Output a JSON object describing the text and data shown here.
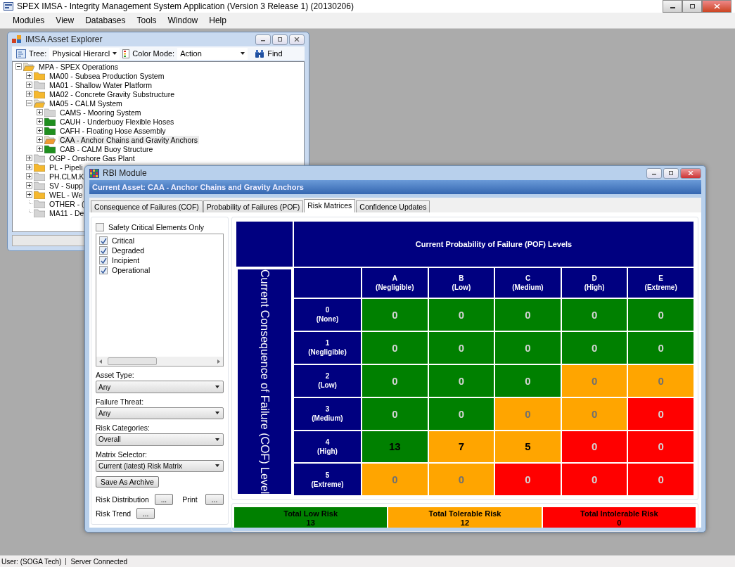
{
  "app_window": {
    "title": "SPEX IMSA - Integrity Management System Application (Version 3 Release 1) (20130206)"
  },
  "menu": [
    "Modules",
    "View",
    "Databases",
    "Tools",
    "Window",
    "Help"
  ],
  "asset_explorer": {
    "title": "IMSA Asset Explorer",
    "tree_label": "Tree:",
    "tree_value": "Physical Hierarcl",
    "color_mode_label": "Color Mode:",
    "color_mode_value": "Action",
    "find": "Find",
    "tree": [
      {
        "label": "MPA - SPEX Operations",
        "color": "#f5b82e",
        "expandable": true,
        "expanded": true,
        "selected": false,
        "children": [
          {
            "label": "MA00 - Subsea Production System",
            "color": "#f5b82e",
            "expandable": true,
            "expanded": false,
            "selected": false
          },
          {
            "label": "MA01 - Shallow Water Platform",
            "color": "#d4d4d4",
            "expandable": true,
            "expanded": false,
            "selected": false
          },
          {
            "label": "MA02 - Concrete Gravity Substructure",
            "color": "#f5b82e",
            "expandable": true,
            "expanded": false,
            "selected": false
          },
          {
            "label": "MA05 - CALM System",
            "color": "#f5b82e",
            "expandable": true,
            "expanded": true,
            "selected": false,
            "children": [
              {
                "label": "CAMS - Mooring System",
                "color": "#d4d4d4",
                "expandable": true,
                "expanded": false,
                "selected": false
              },
              {
                "label": "CAUH - Underbuoy Flexible Hoses",
                "color": "#1f8f1f",
                "expandable": true,
                "expanded": false,
                "selected": false
              },
              {
                "label": "CAFH - Floating Hose Assembly",
                "color": "#1f8f1f",
                "expandable": true,
                "expanded": false,
                "selected": false
              },
              {
                "label": "CAA - Anchor Chains and Gravity Anchors",
                "color": "#f09a30",
                "expandable": true,
                "expanded": false,
                "selected": true
              },
              {
                "label": "CAB - CALM Buoy Structure",
                "color": "#1f8f1f",
                "expandable": true,
                "expanded": false,
                "selected": false
              }
            ]
          },
          {
            "label": "OGP - Onshore Gas Plant",
            "color": "#d4d4d4",
            "expandable": true,
            "expanded": false,
            "selected": false
          },
          {
            "label": "PL - Pipeli",
            "color": "#f5b82e",
            "expandable": true,
            "expanded": false,
            "selected": false
          },
          {
            "label": "PH.CLM.K",
            "color": "#d4d4d4",
            "expandable": true,
            "expanded": false,
            "selected": false
          },
          {
            "label": "SV - Supp",
            "color": "#d4d4d4",
            "expandable": true,
            "expanded": false,
            "selected": false
          },
          {
            "label": "WEL - We",
            "color": "#f5b82e",
            "expandable": true,
            "expanded": false,
            "selected": false
          },
          {
            "label": "OTHER - (",
            "color": "#d4d4d4",
            "expandable": false,
            "expanded": false,
            "selected": false
          },
          {
            "label": "MA11 - De",
            "color": "#d4d4d4",
            "expandable": false,
            "expanded": false,
            "selected": false
          }
        ]
      }
    ]
  },
  "rbi_module": {
    "title": "RBI Module",
    "current_asset": "Current Asset: CAA - Anchor Chains and Gravity Anchors",
    "tabs": [
      {
        "label": "Consequence of Failures (COF)",
        "selected": false
      },
      {
        "label": "Probability of Failures (POF)",
        "selected": false
      },
      {
        "label": "Risk Matrices",
        "selected": true
      },
      {
        "label": "Confidence Updates",
        "selected": false
      }
    ],
    "safety_critical": {
      "label": "Safety Critical Elements Only",
      "checked": false
    },
    "conditions": [
      {
        "label": "Critical",
        "checked": true
      },
      {
        "label": "Degraded",
        "checked": true
      },
      {
        "label": "Incipient",
        "checked": true
      },
      {
        "label": "Operational",
        "checked": true
      }
    ],
    "filters": [
      {
        "label": "Asset Type:",
        "value": "Any"
      },
      {
        "label": "Failure Threat:",
        "value": "Any"
      },
      {
        "label": "Risk Categories:",
        "value": "Overall"
      },
      {
        "label": "Matrix Selector:",
        "value": "Current (latest) Risk Matrix"
      }
    ],
    "save_button": "Save As Archive",
    "actions": [
      {
        "label": "Risk Distribution",
        "button": "..."
      },
      {
        "label": "Print",
        "button": "..."
      },
      {
        "label": "Risk Trend",
        "button": "..."
      }
    ],
    "matrix": {
      "title": "Current Probability of Failure (POF) Levels",
      "side_title": "Current Consequence of Failure (COF) Level",
      "columns": [
        {
          "letter": "A",
          "name": "(Negligible)"
        },
        {
          "letter": "B",
          "name": "(Low)"
        },
        {
          "letter": "C",
          "name": "(Medium)"
        },
        {
          "letter": "D",
          "name": "(High)"
        },
        {
          "letter": "E",
          "name": "(Extreme)"
        }
      ],
      "rows": [
        {
          "number": "0",
          "name": "(None)",
          "cells": [
            {
              "value": "0",
              "color": "#008000",
              "muted": true
            },
            {
              "value": "0",
              "color": "#008000",
              "muted": true
            },
            {
              "value": "0",
              "color": "#008000",
              "muted": true
            },
            {
              "value": "0",
              "color": "#008000",
              "muted": true
            },
            {
              "value": "0",
              "color": "#008000",
              "muted": true
            }
          ]
        },
        {
          "number": "1",
          "name": "(Negligible)",
          "cells": [
            {
              "value": "0",
              "color": "#008000",
              "muted": true
            },
            {
              "value": "0",
              "color": "#008000",
              "muted": true
            },
            {
              "value": "0",
              "color": "#008000",
              "muted": true
            },
            {
              "value": "0",
              "color": "#008000",
              "muted": true
            },
            {
              "value": "0",
              "color": "#008000",
              "muted": true
            }
          ]
        },
        {
          "number": "2",
          "name": "(Low)",
          "cells": [
            {
              "value": "0",
              "color": "#008000",
              "muted": true
            },
            {
              "value": "0",
              "color": "#008000",
              "muted": true
            },
            {
              "value": "0",
              "color": "#008000",
              "muted": true
            },
            {
              "value": "0",
              "color": "#ffa500",
              "muted": true
            },
            {
              "value": "0",
              "color": "#ffa500",
              "muted": true
            }
          ]
        },
        {
          "number": "3",
          "name": "(Medium)",
          "cells": [
            {
              "value": "0",
              "color": "#008000",
              "muted": true
            },
            {
              "value": "0",
              "color": "#008000",
              "muted": true
            },
            {
              "value": "0",
              "color": "#ffa500",
              "muted": true
            },
            {
              "value": "0",
              "color": "#ffa500",
              "muted": true
            },
            {
              "value": "0",
              "color": "#ff0000",
              "muted": true
            }
          ]
        },
        {
          "number": "4",
          "name": "(High)",
          "cells": [
            {
              "value": "13",
              "color": "#008000",
              "muted": false
            },
            {
              "value": "7",
              "color": "#ffa500",
              "muted": false
            },
            {
              "value": "5",
              "color": "#ffa500",
              "muted": false
            },
            {
              "value": "0",
              "color": "#ff0000",
              "muted": true
            },
            {
              "value": "0",
              "color": "#ff0000",
              "muted": true
            }
          ]
        },
        {
          "number": "5",
          "name": "(Extreme)",
          "cells": [
            {
              "value": "0",
              "color": "#ffa500",
              "muted": true
            },
            {
              "value": "0",
              "color": "#ffa500",
              "muted": true
            },
            {
              "value": "0",
              "color": "#ff0000",
              "muted": true
            },
            {
              "value": "0",
              "color": "#ff0000",
              "muted": true
            },
            {
              "value": "0",
              "color": "#ff0000",
              "muted": true
            }
          ]
        }
      ]
    },
    "totals": [
      {
        "label": "Total Low Risk",
        "value": "13",
        "color": "#008000"
      },
      {
        "label": "Total Tolerable Risk",
        "value": "12",
        "color": "#ffa500"
      },
      {
        "label": "Total Intolerable Risk",
        "value": "0",
        "color": "#ff0000"
      }
    ]
  },
  "status_bar": {
    "user": "User:  (SOGA Tech)",
    "server": "Server Connected"
  }
}
